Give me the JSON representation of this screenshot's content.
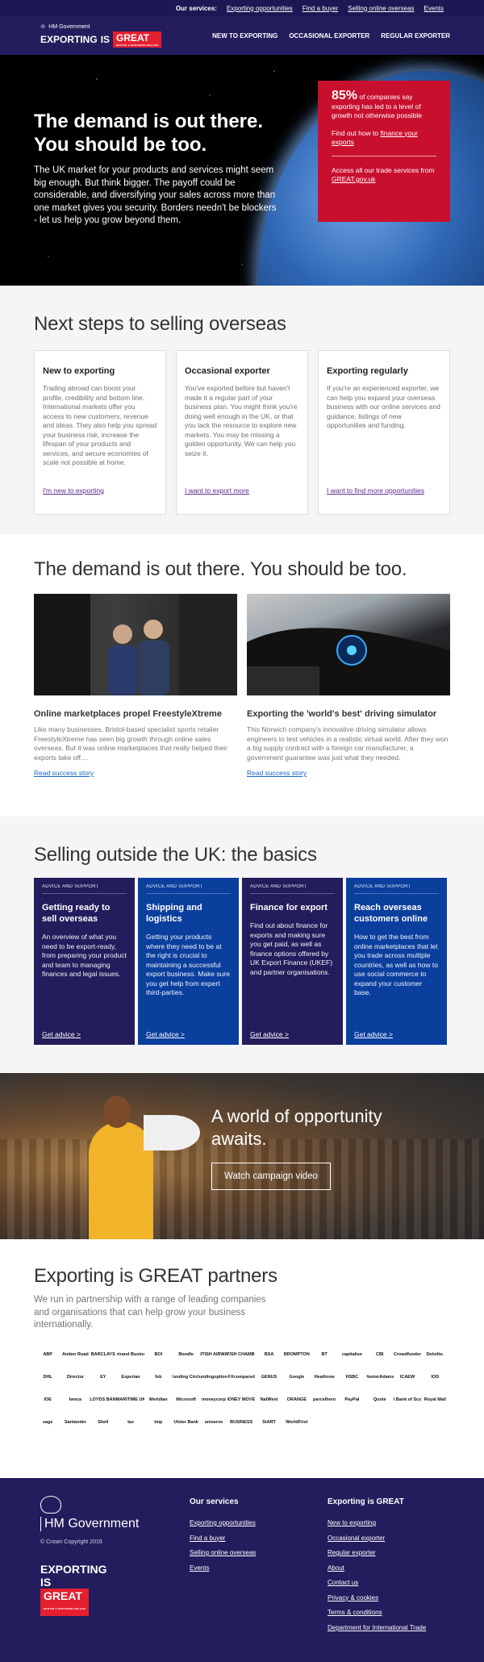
{
  "topbar": {
    "label": "Our services:",
    "links": [
      "Exporting opportunities",
      "Find a buyer",
      "Selling online overseas",
      "Events"
    ]
  },
  "header": {
    "gov": "HM Government",
    "exporting": "EXPORTING",
    "is": "IS",
    "great": "GREAT",
    "great_sub": "BRITAIN & NORTHERN IRELAND",
    "nav": [
      "NEW TO EXPORTING",
      "OCCASIONAL EXPORTER",
      "REGULAR EXPORTER"
    ]
  },
  "hero": {
    "title": "The demand is out there. You should be too.",
    "text": "The UK market for your products and services might seem big enough. But think bigger. The payoff could be considerable, and diversifying your sales across more than one market gives you security. Borders needn't be blockers - let us help you grow beyond them.",
    "stat_number": "85%",
    "stat_text": "of companies say exporting has led to a level of growth not otherwise possible",
    "stat_cta_prefix": "Find out how to",
    "stat_cta_link": "finance your exports",
    "services_prefix": "Access all our trade services from",
    "services_link": "GREAT.gov.uk"
  },
  "next_steps": {
    "title": "Next steps to selling overseas",
    "items": [
      {
        "title": "New to exporting",
        "text": "Trading abroad can boost your profile, credibility and bottom line. International markets offer you access to new customers, revenue and ideas. They also help you spread your business risk, increase the lifespan of your products and services, and secure economies of scale not possible at home.",
        "link": "I'm new to exporting"
      },
      {
        "title": "Occasional exporter",
        "text": "You've exported before but haven't made it a regular part of your business plan. You might think you're doing well enough in the UK, or that you lack the resource to explore new markets. You may be missing a golden opportunity. We can help you seize it.",
        "link": "I want to export more"
      },
      {
        "title": "Exporting regularly",
        "text": "If you're an experienced exporter, we can help you expand your overseas business with our online services and guidance, listings of new opportunities and funding.",
        "link": "I want to find more opportunities"
      }
    ]
  },
  "stories": {
    "title": "The demand is out there. You should be too.",
    "items": [
      {
        "title": "Online marketplaces propel FreestyleXtreme",
        "text": "Like many businesses, Bristol-based specialist sports retailer FreestyleXtreme has seen big growth through online sales overseas. But it was online marketplaces that really helped their exports take off....",
        "link": "Read success story"
      },
      {
        "title": "Exporting the 'world's best' driving simulator",
        "text": "This Norwich company's innovative driving simulator allows engineers to test vehicles in a realistic virtual world. After they won a big supply contract with a foreign car manufacturer, a government guarantee was just what they needed.",
        "link": "Read success story"
      }
    ]
  },
  "basics": {
    "title": "Selling outside the UK: the basics",
    "cards": [
      {
        "tag": "ADVICE AND SUPPORT",
        "title": "Getting ready to sell overseas",
        "text": "An overview of what you need to be export-ready, from preparing your product and team to managing finances and legal issues.",
        "link": "Get advice >"
      },
      {
        "tag": "ADVICE AND SUPPORT",
        "title": "Shipping and logistics",
        "text": "Getting your products where they need to be at the right is crucial to maintaining a successful export business. Make sure you get help from expert third-parties.",
        "link": "Get advice >"
      },
      {
        "tag": "ADVICE AND SUPPORT",
        "title": "Finance for export",
        "text": "Find out about finance for exports and making sure you get paid, as well as finance options offered by UK Export Finance (UKEF) and partner organisations.",
        "link": "Get advice >"
      },
      {
        "tag": "ADVICE AND SUPPORT",
        "title": "Reach overseas customers online",
        "text": "How to get the best from online marketplaces that let you trade across multiple countries, as well as how to use social commerce to expand your customer base.",
        "link": "Get advice >"
      }
    ]
  },
  "campaign": {
    "title": "A world of opportunity awaits.",
    "button": "Watch campaign video"
  },
  "partners": {
    "title": "Exporting is GREAT partners",
    "lead": "We run in partnership with a range of leading companies and organisations that can help grow your business internationally.",
    "logos": [
      "ABP",
      "Amber Road",
      "BARCLAYS",
      "Bertrand Business",
      "BOI",
      "Boodle",
      "BRITISH AIRWAYS",
      "BRITISH CHAMBERS",
      "BSA",
      "BROMPTON",
      "BT",
      "capitalise",
      "CBI",
      "Crowdfunder",
      "Deloitte.",
      "DHL",
      "Director",
      "EY",
      "Experian",
      "fsb",
      "Funding Circle",
      "fundingoptions",
      "FXcompared",
      "GENUS",
      "Google",
      "Heathrow",
      "HSBC",
      "HunterAdams",
      "ICAEW",
      "IOD",
      "IOE",
      "Iwoca",
      "LLOYDS BANK",
      "MARITIME UK",
      "Meridian",
      "Microsoft",
      "moneycorp",
      "MONEY MOVER",
      "NatWest",
      "ORANGE",
      "parcelhero",
      "PayPal",
      "Quote",
      "Royal Bank of Scotland",
      "Royal Mail",
      "sage",
      "Santander",
      "Shell",
      "tax",
      "tmp",
      "Ulster Bank",
      "uniserve",
      "BUSINESS",
      "StART",
      "WorldFirst"
    ]
  },
  "footer": {
    "gov": "HM Government",
    "copyright": "© Crown Copyright 2016",
    "exporting": "EXPORTING",
    "is": "IS",
    "great": "GREAT",
    "great_sub": "BRITAIN & NORTHERN IRELAND",
    "services_title": "Our services",
    "services": [
      "Exporting opportunities",
      "Find a buyer",
      "Selling online overseas",
      "Events"
    ],
    "eig_title": "Exporting is GREAT",
    "eig_links": [
      "New to exporting",
      "Occasional exporter",
      "Regular exporter",
      "About",
      "Contact us",
      "Privacy & cookies",
      "Terms & conditions",
      "Department for International Trade"
    ]
  },
  "colors": {
    "navy": "#231d5d",
    "red": "#c8102e",
    "blue": "#0b3f9e",
    "link_purple": "#5b2b8f",
    "link_blue": "#1b63c8"
  }
}
